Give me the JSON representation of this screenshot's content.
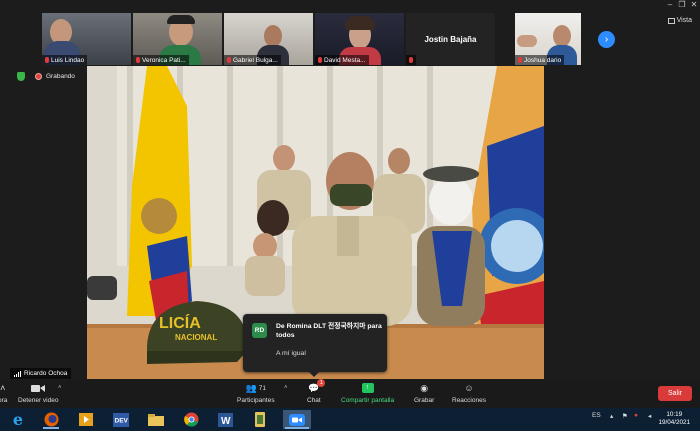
{
  "window": {
    "controls": [
      "–",
      "❐",
      "✕"
    ],
    "view_label": "Vista"
  },
  "participants": [
    {
      "name": "Luis Lindao"
    },
    {
      "name": "Veronica Pati..."
    },
    {
      "name": "Gabriel Bulga..."
    },
    {
      "name": "David Mesta..."
    },
    {
      "name": "Jostin Bajaña",
      "display_name": "Jostin Bajaña"
    },
    {
      "name": "Joshua dario"
    }
  ],
  "recording": {
    "label": "Grabando"
  },
  "speaker": {
    "name": "Ricardo Ochoa"
  },
  "chat_popup": {
    "avatar_initials": "RD",
    "from": "De Romina DLT 전정국하지마 para todos",
    "message": "A mí igual"
  },
  "toolbar": {
    "left_cut_label": "ora",
    "video_label": "Detener video",
    "participants_count": "71",
    "participants_label": "Participantes",
    "chat_label": "Chat",
    "chat_badge": "1",
    "share_label": "Compartir pantalla",
    "record_label": "Grabar",
    "reactions_label": "Reacciones",
    "leave_label": "Salir"
  },
  "taskbar": {
    "language": "ES",
    "time": "10:19",
    "date": "19/04/2021"
  },
  "colors": {
    "accent": "#2d8cff",
    "share": "#22c55e",
    "leave": "#d93a3a",
    "taskbar": "#0c1f33"
  }
}
